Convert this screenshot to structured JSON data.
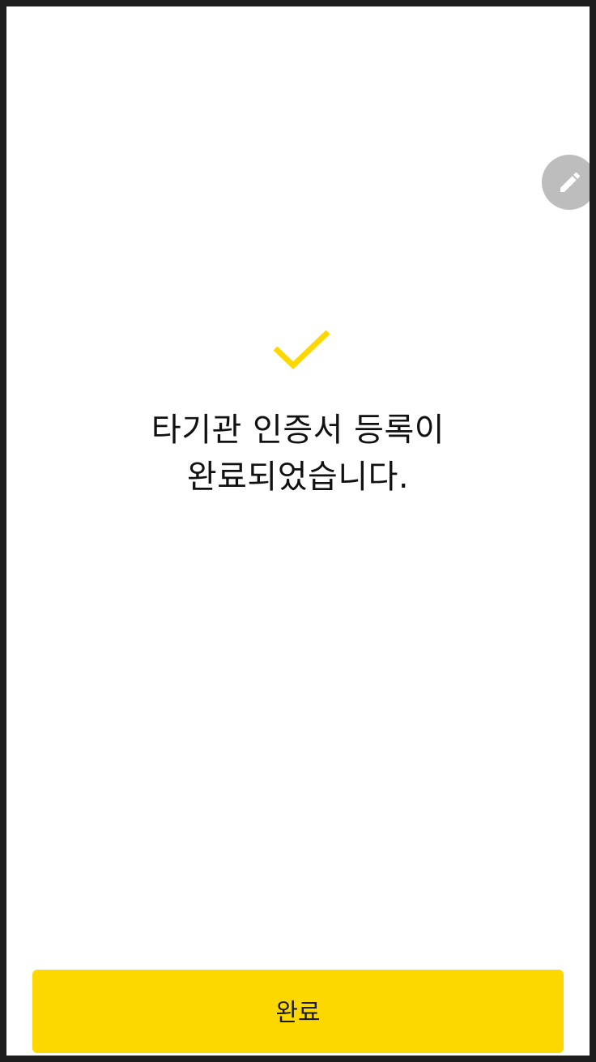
{
  "colors": {
    "accent": "#fdd800",
    "fab": "#bdbdbd",
    "text": "#111111",
    "frame": "#1e1e1e"
  },
  "icons": {
    "check": "check-icon",
    "edit": "pencil-icon"
  },
  "message": {
    "line1": "타기관 인증서 등록이",
    "line2": "완료되었습니다."
  },
  "footer": {
    "done_label": "완료"
  }
}
